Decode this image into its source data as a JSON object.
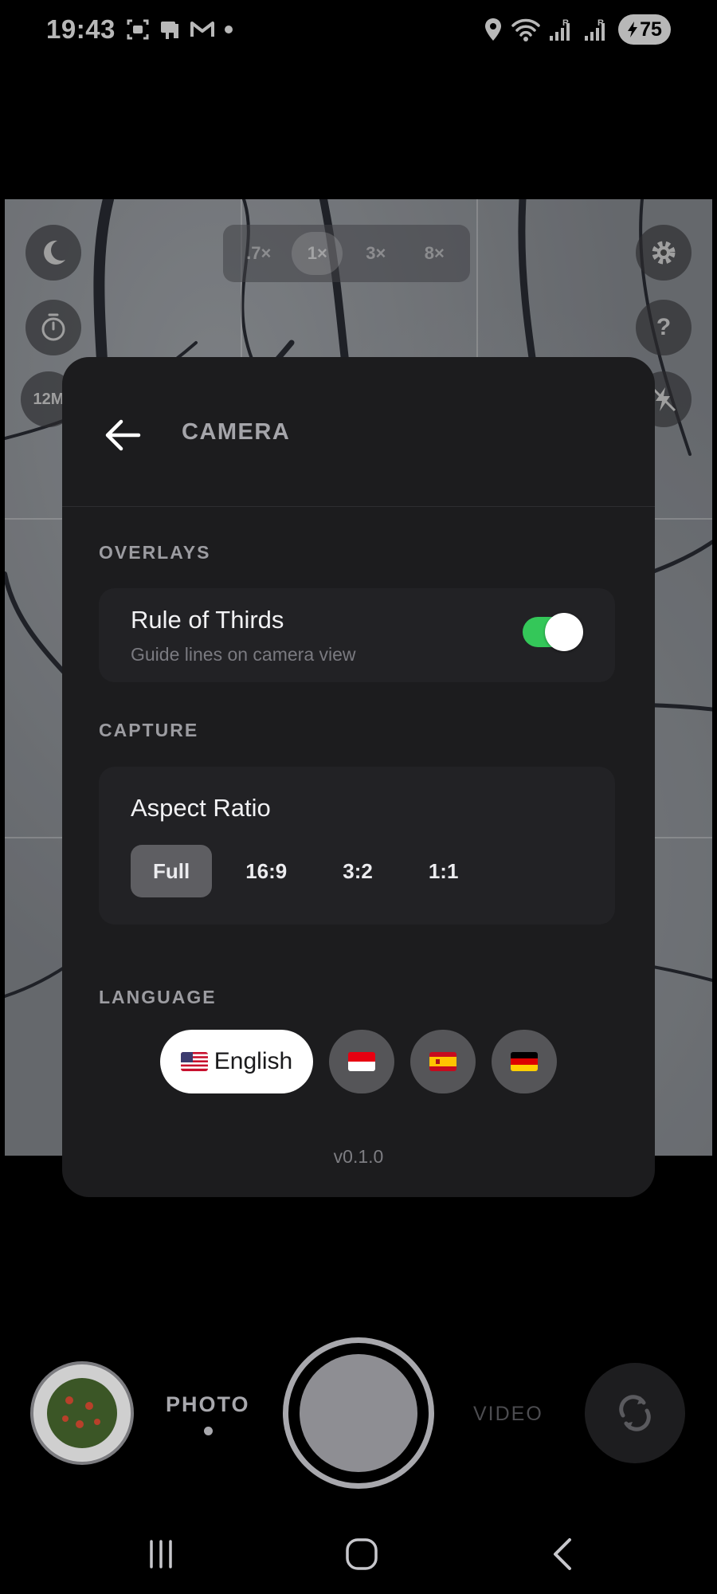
{
  "status_bar": {
    "time": "19:43",
    "battery": "75"
  },
  "camera": {
    "zoom_options": [
      ".7×",
      "1×",
      "3×",
      "8×"
    ],
    "active_zoom": "1×",
    "resolution_badge": "12M",
    "help_label": "?",
    "mode_photo": "PHOTO",
    "mode_video": "VIDEO"
  },
  "settings": {
    "title": "CAMERA",
    "overlays": {
      "section_label": "OVERLAYS",
      "rule_of_thirds_title": "Rule of Thirds",
      "rule_of_thirds_sub": "Guide lines on camera view",
      "rule_of_thirds_enabled": true
    },
    "capture": {
      "section_label": "CAPTURE",
      "aspect_ratio_title": "Aspect Ratio",
      "options": [
        "Full",
        "16:9",
        "3:2",
        "1:1"
      ],
      "selected": "Full"
    },
    "language": {
      "section_label": "LANGUAGE",
      "selected_label": "English",
      "options": [
        "English",
        "Indonesian",
        "Spanish",
        "German"
      ]
    },
    "version": "v0.1.0"
  },
  "colors": {
    "toggle_on": "#34c759",
    "panel_bg": "#1c1c1e",
    "card_bg": "#222225"
  },
  "icons": [
    "night-mode-icon",
    "timer-icon",
    "settings-gear-icon",
    "help-icon",
    "flash-off-icon",
    "back-arrow-icon",
    "switch-camera-icon"
  ]
}
